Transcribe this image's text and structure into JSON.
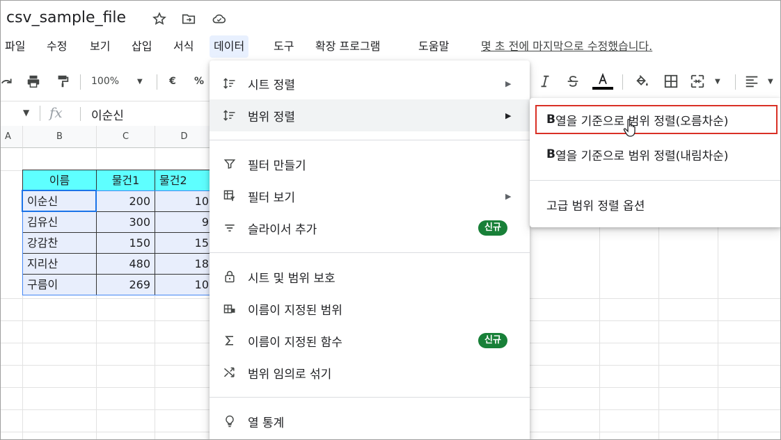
{
  "title_bar": {
    "doc_title": "csv_sample_file",
    "icons": [
      "star-icon",
      "move-to-folder-icon",
      "cloud-status-icon"
    ]
  },
  "menu_bar": {
    "items": [
      "파일",
      "수정",
      "보기",
      "삽입",
      "서식",
      "데이터",
      "도구",
      "확장 프로그램",
      "도움말"
    ],
    "active": "데이터",
    "last_edit": "몇 초 전에 마지막으로 수정했습니다."
  },
  "toolbar": {
    "zoom": "100%",
    "currency": "€",
    "percent": "%",
    "icons": [
      "redo-icon",
      "print-icon",
      "paint-format-icon",
      "italic-icon",
      "strikethrough-icon",
      "text-color-icon",
      "fill-color-icon",
      "borders-icon",
      "merge-cells-icon",
      "align-icon"
    ],
    "text_color": "#000000"
  },
  "formula_bar": {
    "fx": "fx",
    "value": "이순신"
  },
  "grid": {
    "columns": [
      "A",
      "B",
      "C",
      "D"
    ],
    "table": {
      "headers": [
        "이름",
        "물건1",
        "물건2"
      ],
      "rows": [
        [
          "이순신",
          "200",
          "10"
        ],
        [
          "김유신",
          "300",
          "9"
        ],
        [
          "강감찬",
          "150",
          "15"
        ],
        [
          "지리산",
          "480",
          "18"
        ],
        [
          "구름이",
          "269",
          "10"
        ]
      ]
    },
    "header_color": "#5effff",
    "selection_color": "#1a73e8"
  },
  "data_menu": {
    "items": [
      {
        "label": "시트 정렬",
        "icon": "sort-icon",
        "submenu": true
      },
      {
        "label": "범위 정렬",
        "icon": "sort-range-icon",
        "submenu": true,
        "hover": true
      },
      {
        "label": "필터 만들기",
        "icon": "filter-icon"
      },
      {
        "label": "필터 보기",
        "icon": "filter-views-icon",
        "submenu": true
      },
      {
        "label": "슬라이서 추가",
        "icon": "slicer-icon",
        "badge": "신규"
      },
      {
        "label": "시트 및 범위 보호",
        "icon": "lock-icon"
      },
      {
        "label": "이름이 지정된 범위",
        "icon": "named-range-icon"
      },
      {
        "label": "이름이 지정된 함수",
        "icon": "sigma-icon",
        "badge": "신규"
      },
      {
        "label": "범위 임의로 섞기",
        "icon": "shuffle-icon"
      },
      {
        "label": "열 통계",
        "icon": "lightbulb-icon"
      }
    ],
    "badge_color": "#188038"
  },
  "sub_menu": {
    "items": [
      {
        "bold": "B",
        "label": "열을 기준으로 범위 정렬(오름차순)"
      },
      {
        "bold": "B",
        "label": "열을 기준으로 범위 정렬(내림차순)"
      },
      {
        "label": "고급 범위 정렬 옵션"
      }
    ],
    "highlight_color": "#d93025"
  }
}
